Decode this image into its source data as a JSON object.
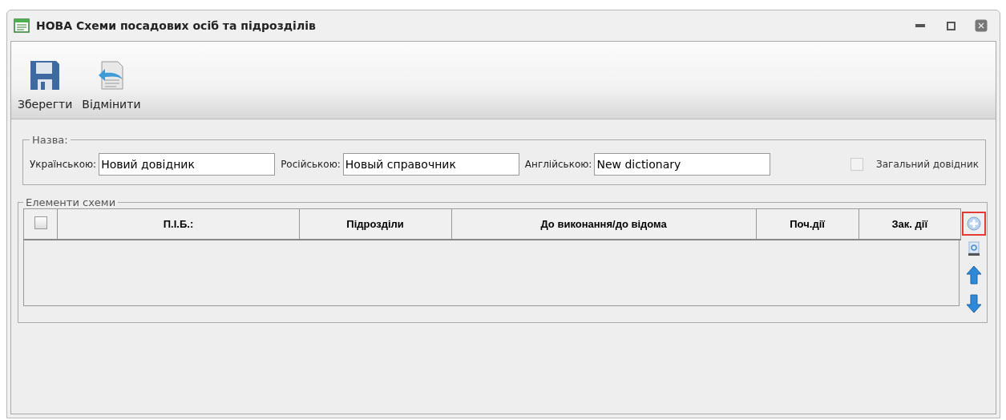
{
  "window": {
    "title": "НОВА Схеми посадових осіб та підрозділів"
  },
  "toolbar": [
    {
      "label": "Зберегти",
      "kind": "save"
    },
    {
      "label": "Відмінити",
      "kind": "undo"
    }
  ],
  "name_group": {
    "legend": "Назва:",
    "fields": [
      {
        "label": "Українською:",
        "value": "Новий довідник"
      },
      {
        "label": "Російською:",
        "value": "Новый справочник"
      },
      {
        "label": "Англійською:",
        "value": "New dictionary"
      }
    ],
    "common": {
      "label": "Загальний довідник",
      "checked": false,
      "disabled": true
    }
  },
  "elements_group": {
    "legend": "Елементи схеми",
    "select_all": {
      "checked": false
    },
    "columns": [
      "П.І.Б.:",
      "Підрозділи",
      "До виконання/до відома",
      "Поч.дії",
      "Зак. дії"
    ],
    "actions": [
      {
        "kind": "add",
        "highlighted": true
      },
      {
        "kind": "delete",
        "highlighted": false
      },
      {
        "kind": "up",
        "highlighted": false
      },
      {
        "kind": "down",
        "highlighted": false
      }
    ]
  }
}
